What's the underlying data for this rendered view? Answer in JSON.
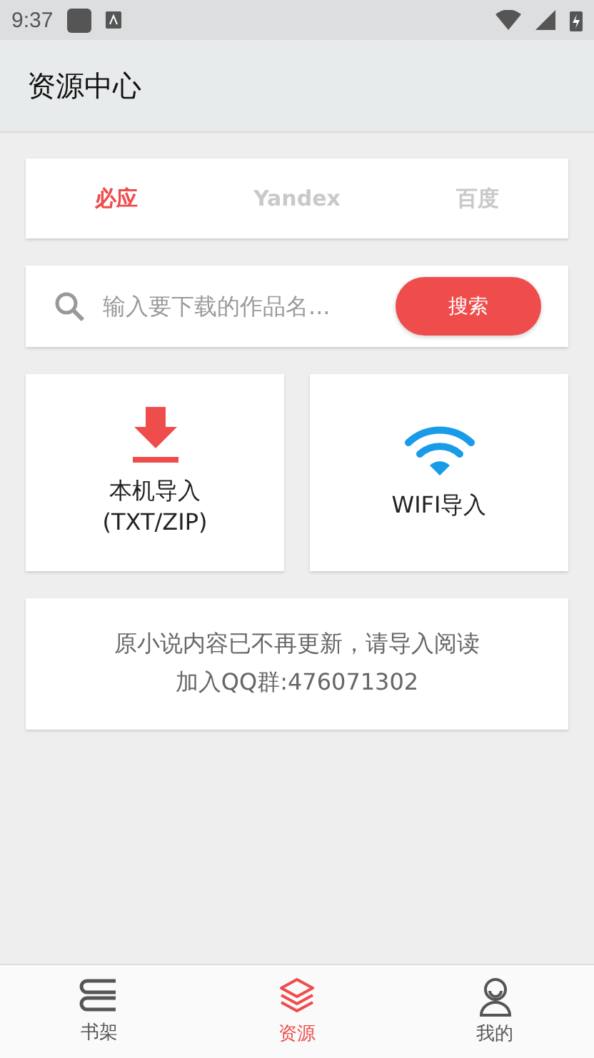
{
  "status_bar": {
    "time": "9:37"
  },
  "app_bar": {
    "title": "资源中心"
  },
  "tabs": [
    {
      "label": "必应",
      "selected": true
    },
    {
      "label": "Yandex",
      "selected": false
    },
    {
      "label": "百度",
      "selected": false
    }
  ],
  "search": {
    "placeholder": "输入要下载的作品名...",
    "button": "搜索"
  },
  "import_options": [
    {
      "kind": "download",
      "label": "本机导入\n(TXT/ZIP)"
    },
    {
      "kind": "wifi",
      "label": "WIFI导入"
    }
  ],
  "notice": {
    "lines": [
      "原小说内容已不再更新，请导入阅读",
      "加入QQ群:476071302"
    ]
  },
  "bottom_nav": [
    {
      "kind": "shelf",
      "label": "书架",
      "selected": false
    },
    {
      "kind": "layers",
      "label": "资源",
      "selected": true
    },
    {
      "kind": "person",
      "label": "我的",
      "selected": false
    }
  ]
}
